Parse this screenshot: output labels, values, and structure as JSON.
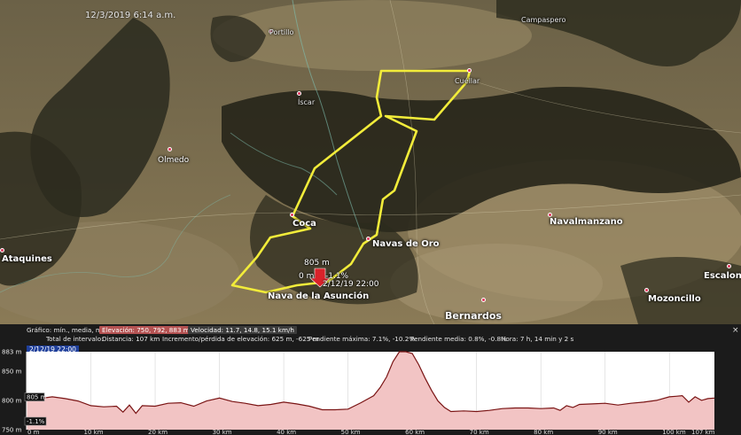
{
  "map": {
    "date_stamp": "12/3/2019 6:14 a.m.",
    "places": [
      {
        "id": "campaspero",
        "name": "Campaspero"
      },
      {
        "id": "portillo",
        "name": "Portillo"
      },
      {
        "id": "cuellar",
        "name": "Cuéllar"
      },
      {
        "id": "iscar",
        "name": "Íscar"
      },
      {
        "id": "olmedo",
        "name": "Olmedo"
      },
      {
        "id": "coca",
        "name": "Coca"
      },
      {
        "id": "navas",
        "name": "Navas de Oro"
      },
      {
        "id": "navalmanzano",
        "name": "Navalmanzano"
      },
      {
        "id": "ataquines",
        "name": "Ataquines"
      },
      {
        "id": "nava",
        "name": "Nava de la Asunción"
      },
      {
        "id": "bernardos",
        "name": "Bernardos"
      },
      {
        "id": "mozoncillo",
        "name": "Mozoncillo"
      },
      {
        "id": "escalona",
        "name": "Escalona"
      }
    ],
    "track_labels": {
      "elevation": "805 m",
      "distance": "0 m",
      "slope": "-1.1%",
      "time": "2/12/19 22:00"
    },
    "track_color": "#f2ec3a"
  },
  "panel": {
    "row1": {
      "label": "Gráfico: mín., media, máx.",
      "elevation": "Elevación: 750, 792, 883 m",
      "speed": "Velocidad: 11.7, 14.8, 15.1 km/h"
    },
    "row2": {
      "label": "Total de intervalo:",
      "distance": "Distancia: 107 km",
      "gain": "Incremento/pérdida de elevación: 625 m, -625 m",
      "max_slope": "Pendiente máxima: 7.1%, -10.2%",
      "avg_slope": "Pendiente media: 0.8%, -0.8%",
      "time": "Hora: 7 h, 14 min y 2 s"
    },
    "current_time": "2/12/19 22:00",
    "close_label": "×"
  },
  "chart_data": {
    "type": "area",
    "title": "",
    "xlabel": "",
    "ylabel": "",
    "y_ticks": [
      "883 m",
      "850 m",
      "800 m",
      "750 m"
    ],
    "x_ticks": [
      "0 m",
      "10 km",
      "20 km",
      "30 km",
      "40 km",
      "50 km",
      "60 km",
      "70 km",
      "80 km",
      "90 km",
      "100 km",
      "107 km"
    ],
    "cursor_labels": {
      "elevation": "805 m",
      "slope": "-1.1%"
    },
    "xlim": [
      0,
      107
    ],
    "ylim": [
      750,
      883
    ],
    "series": [
      {
        "x": [
          0,
          2,
          4,
          6,
          8,
          10,
          12,
          14,
          15,
          16,
          17,
          18,
          20,
          22,
          24,
          26,
          28,
          30,
          32,
          34,
          36,
          38,
          40,
          42,
          44,
          46,
          48,
          50,
          52,
          54,
          55,
          56,
          57,
          58,
          59,
          60,
          61,
          62,
          63,
          64,
          65,
          66,
          68,
          70,
          72,
          74,
          76,
          78,
          80,
          82,
          83,
          84,
          85,
          86,
          88,
          90,
          92,
          94,
          96,
          98,
          100,
          101,
          102,
          103,
          104,
          105,
          106,
          107
        ],
        "values": [
          801,
          803,
          806,
          803,
          799,
          791,
          789,
          790,
          780,
          792,
          778,
          791,
          790,
          795,
          796,
          790,
          799,
          804,
          798,
          795,
          791,
          793,
          797,
          794,
          790,
          784,
          784,
          785,
          796,
          808,
          822,
          840,
          866,
          883,
          883,
          880,
          861,
          838,
          817,
          799,
          788,
          781,
          782,
          781,
          783,
          786,
          787,
          787,
          786,
          787,
          783,
          791,
          788,
          793,
          794,
          795,
          792,
          795,
          797,
          800,
          806,
          807,
          808,
          797,
          806,
          800,
          803,
          804
        ]
      }
    ]
  }
}
